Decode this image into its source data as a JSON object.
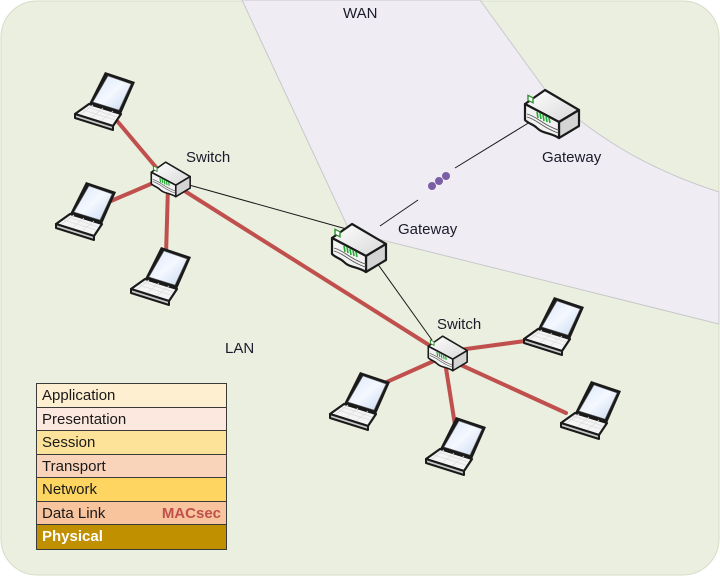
{
  "diagram": {
    "title_regions": {
      "wan": "WAN",
      "lan": "LAN"
    },
    "colors": {
      "background": "#ebefdf",
      "wan_region": "#efedf3",
      "lan_link": "#c0504d",
      "wan_link": "#1a1a1a",
      "ellipsis_dots": "#7b5fa6"
    },
    "devices": [
      {
        "id": "switch1",
        "type": "switch",
        "label": "Switch"
      },
      {
        "id": "switch2",
        "type": "switch",
        "label": "Switch"
      },
      {
        "id": "gateway1",
        "type": "gateway",
        "label": "Gateway"
      },
      {
        "id": "gateway2",
        "type": "gateway",
        "label": "Gateway"
      }
    ],
    "laptops_per_switch": {
      "switch1": 3,
      "switch2": 4
    },
    "links": [
      {
        "from": "switch1",
        "to": "switch2",
        "kind": "lan"
      },
      {
        "from": "switch1",
        "to": "gateway1",
        "kind": "wan"
      },
      {
        "from": "gateway1",
        "to": "switch2",
        "kind": "wan"
      },
      {
        "from": "gateway1",
        "to": "gateway2",
        "kind": "wan",
        "via": "ellipsis"
      }
    ]
  },
  "osi_stack": {
    "layers": [
      {
        "name": "Application",
        "color": "#fdefd0",
        "text_color": "#1a1a1a"
      },
      {
        "name": "Presentation",
        "color": "#fce8de",
        "text_color": "#1a1a1a"
      },
      {
        "name": "Session",
        "color": "#fde39a",
        "text_color": "#1a1a1a"
      },
      {
        "name": "Transport",
        "color": "#f9d3ba",
        "text_color": "#1a1a1a"
      },
      {
        "name": "Network",
        "color": "#fdd560",
        "text_color": "#1a1a1a"
      },
      {
        "name": "Data Link",
        "color": "#f8c49d",
        "text_color": "#1a1a1a",
        "tag": "MACsec"
      },
      {
        "name": "Physical",
        "color": "#c09000",
        "text_color": "#ffffff",
        "bold": true
      }
    ]
  }
}
